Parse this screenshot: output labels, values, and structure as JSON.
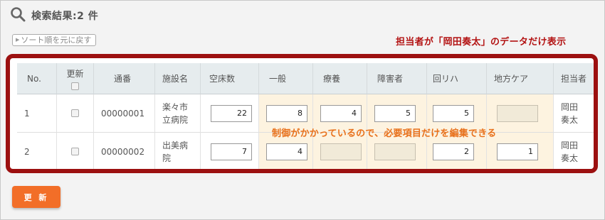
{
  "header": {
    "title": "検索結果:2 件"
  },
  "sort_button": {
    "label": "ソート順を元に戻す"
  },
  "annotations": {
    "top": "担当者が「岡田奏太」のデータだけ表示",
    "middle": "制御がかかっているので、必要項目だけを編集できる"
  },
  "table": {
    "headers": {
      "no": "No.",
      "update": "更新",
      "serial": "通番",
      "facility": "施設名",
      "vacant": "空床数",
      "general": "一般",
      "recuperation": "療養",
      "disability": "障害者",
      "rehab": "回リハ",
      "community": "地方ケア",
      "manager": "担当者"
    },
    "rows": [
      {
        "no": "1",
        "serial": "00000001",
        "facility": "楽々市\n立病院",
        "vacant": "22",
        "general": "8",
        "recuperation": "4",
        "disability": "5",
        "rehab": "5",
        "community": "",
        "manager": "岡田\n奏太"
      },
      {
        "no": "2",
        "serial": "00000002",
        "facility": "出美病\n院",
        "vacant": "7",
        "general": "4",
        "recuperation": "",
        "disability": "",
        "rehab": "2",
        "community": "1",
        "manager": "岡田\n奏太"
      }
    ]
  },
  "update_button": {
    "label": "更 新"
  },
  "colors": {
    "accent": "#f26e28",
    "frame": "#9c1010",
    "annotation_red": "#b31212",
    "annotation_orange": "#e8701a",
    "highlight": "#fdf3e0"
  }
}
